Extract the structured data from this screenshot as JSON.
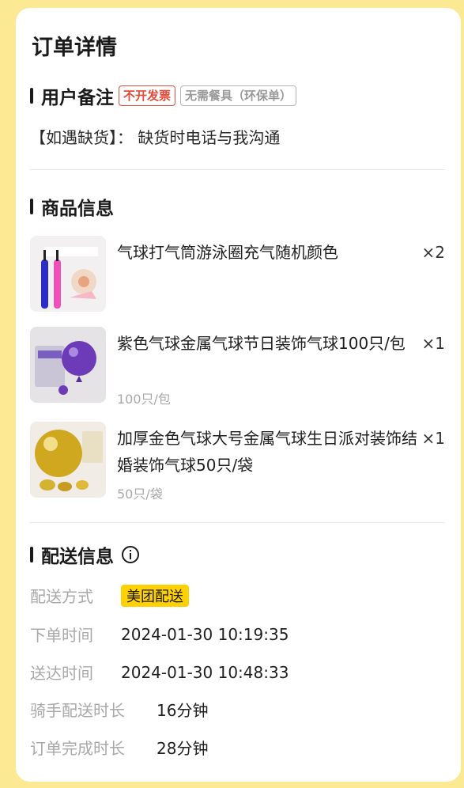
{
  "page_title": "订单详情",
  "remark_section": {
    "title": "用户备注",
    "tags": [
      "不开发票",
      "无需餐具（环保单）"
    ],
    "remark_text": "【如遇缺货】： 缺货时电话与我沟通"
  },
  "goods_section": {
    "title": "商品信息",
    "items": [
      {
        "name": "气球打气筒游泳圈充气随机颜色",
        "qty": "×2",
        "spec": ""
      },
      {
        "name": "紫色气球金属气球节日装饰气球100只/包",
        "qty": "×1",
        "spec": "100只/包"
      },
      {
        "name": "加厚金色气球大号金属气球生日派对装饰结婚装饰气球50只/袋",
        "qty": "×1",
        "spec": "50只/袋"
      }
    ]
  },
  "delivery_section": {
    "title": "配送信息",
    "rows": [
      {
        "label": "配送方式",
        "value": "美团配送"
      },
      {
        "label": "下单时间",
        "value": "2024-01-30 10:19:35"
      },
      {
        "label": "送达时间",
        "value": "2024-01-30 10:48:33"
      },
      {
        "label": "骑手配送时长",
        "value": "16分钟"
      },
      {
        "label": "订单完成时长",
        "value": "28分钟"
      }
    ]
  },
  "colors": {
    "background": "#fbe993",
    "accent_yellow": "#ffd100",
    "tag_red": "#e34b3a"
  }
}
